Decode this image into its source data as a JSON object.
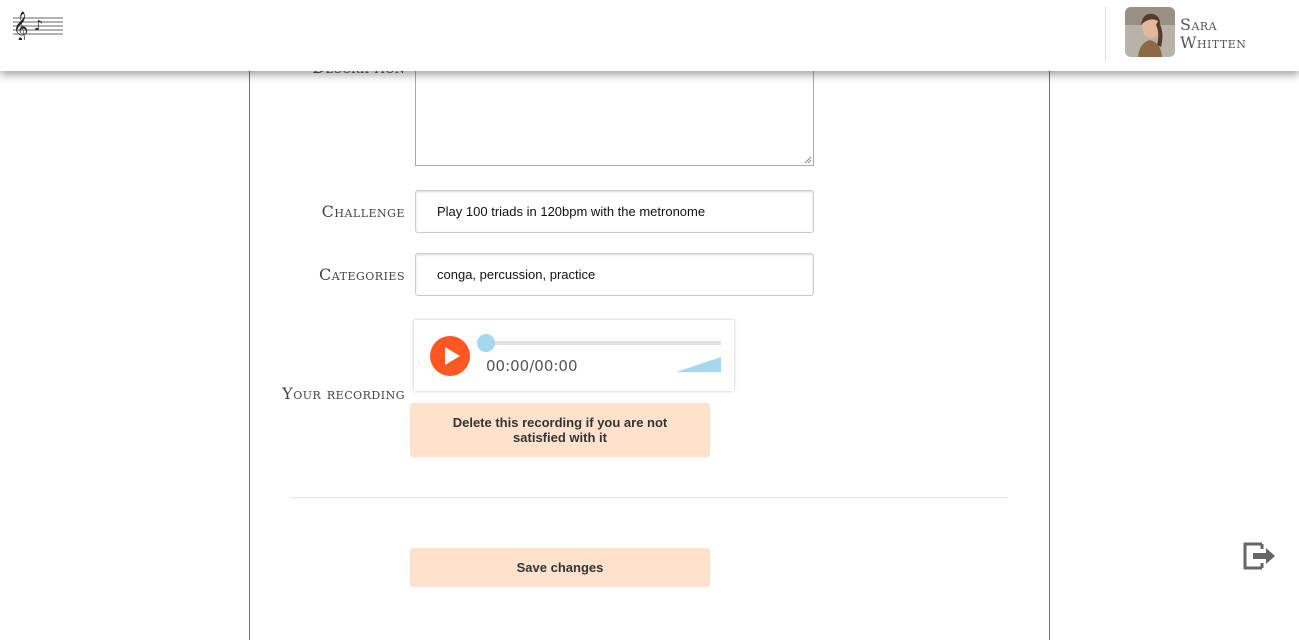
{
  "header": {
    "user_name": "Sara Whitten"
  },
  "form": {
    "description_label": "Description",
    "challenge_label": "Challenge",
    "challenge_value": "Play 100 triads in 120bpm with the metronome",
    "categories_label": "Categories",
    "categories_value": "conga, percussion, practice",
    "recording_label": "Your recording",
    "delete_recording_label": "Delete this recording if you are not satisfied with it",
    "save_label": "Save changes"
  },
  "player": {
    "time_display": "00:00/00:00",
    "progress": 0,
    "volume": 1.0
  },
  "colors": {
    "play_button": "#ff5722",
    "player_accent": "#a3d8ef",
    "button_bg": "#ffe1cc"
  },
  "icons": {
    "logo": "music-staff-logo-icon",
    "play": "play-icon",
    "volume": "volume-icon",
    "logout": "logout-icon"
  }
}
